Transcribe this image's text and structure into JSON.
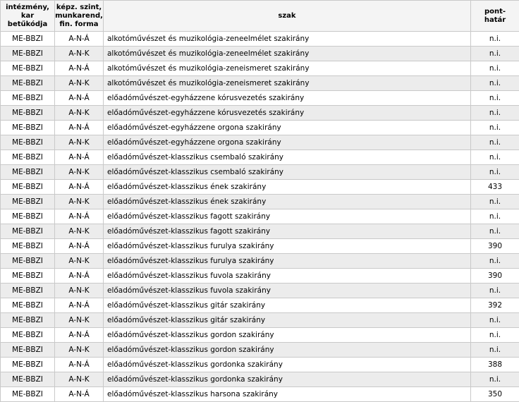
{
  "header": {
    "col1": [
      "intézmény,",
      "kar betűkódja"
    ],
    "col2": [
      "képz. szint,",
      "munkarend,",
      "fin. forma"
    ],
    "col3": "szak",
    "col4": [
      "pont-",
      "határ"
    ]
  },
  "rows": [
    {
      "inst": "ME-BBZI",
      "form": "A-N-Á",
      "major": "alkotóművészet és muzikológia-zeneelmélet szakirány",
      "score": "n.i."
    },
    {
      "inst": "ME-BBZI",
      "form": "A-N-K",
      "major": "alkotóművészet és muzikológia-zeneelmélet szakirány",
      "score": "n.i."
    },
    {
      "inst": "ME-BBZI",
      "form": "A-N-Á",
      "major": "alkotóművészet és muzikológia-zeneismeret szakirány",
      "score": "n.i."
    },
    {
      "inst": "ME-BBZI",
      "form": "A-N-K",
      "major": "alkotóművészet és muzikológia-zeneismeret szakirány",
      "score": "n.i."
    },
    {
      "inst": "ME-BBZI",
      "form": "A-N-Á",
      "major": "előadóművészet-egyházzene kórusvezetés szakirány",
      "score": "n.i."
    },
    {
      "inst": "ME-BBZI",
      "form": "A-N-K",
      "major": "előadóművészet-egyházzene kórusvezetés szakirány",
      "score": "n.i."
    },
    {
      "inst": "ME-BBZI",
      "form": "A-N-Á",
      "major": "előadóművészet-egyházzene orgona szakirány",
      "score": "n.i."
    },
    {
      "inst": "ME-BBZI",
      "form": "A-N-K",
      "major": "előadóművészet-egyházzene orgona szakirány",
      "score": "n.i."
    },
    {
      "inst": "ME-BBZI",
      "form": "A-N-Á",
      "major": "előadóművészet-klasszikus csembaló szakirány",
      "score": "n.i."
    },
    {
      "inst": "ME-BBZI",
      "form": "A-N-K",
      "major": "előadóművészet-klasszikus csembaló szakirány",
      "score": "n.i."
    },
    {
      "inst": "ME-BBZI",
      "form": "A-N-Á",
      "major": "előadóművészet-klasszikus ének szakirány",
      "score": "433"
    },
    {
      "inst": "ME-BBZI",
      "form": "A-N-K",
      "major": "előadóművészet-klasszikus ének szakirány",
      "score": "n.i."
    },
    {
      "inst": "ME-BBZI",
      "form": "A-N-Á",
      "major": "előadóművészet-klasszikus fagott szakirány",
      "score": "n.i."
    },
    {
      "inst": "ME-BBZI",
      "form": "A-N-K",
      "major": "előadóművészet-klasszikus fagott szakirány",
      "score": "n.i."
    },
    {
      "inst": "ME-BBZI",
      "form": "A-N-Á",
      "major": "előadóművészet-klasszikus furulya szakirány",
      "score": "390"
    },
    {
      "inst": "ME-BBZI",
      "form": "A-N-K",
      "major": "előadóművészet-klasszikus furulya szakirány",
      "score": "n.i."
    },
    {
      "inst": "ME-BBZI",
      "form": "A-N-Á",
      "major": "előadóművészet-klasszikus fuvola szakirány",
      "score": "390"
    },
    {
      "inst": "ME-BBZI",
      "form": "A-N-K",
      "major": "előadóművészet-klasszikus fuvola szakirány",
      "score": "n.i."
    },
    {
      "inst": "ME-BBZI",
      "form": "A-N-Á",
      "major": "előadóművészet-klasszikus gitár szakirány",
      "score": "392"
    },
    {
      "inst": "ME-BBZI",
      "form": "A-N-K",
      "major": "előadóművészet-klasszikus gitár szakirány",
      "score": "n.i."
    },
    {
      "inst": "ME-BBZI",
      "form": "A-N-Á",
      "major": "előadóművészet-klasszikus gordon szakirány",
      "score": "n.i."
    },
    {
      "inst": "ME-BBZI",
      "form": "A-N-K",
      "major": "előadóművészet-klasszikus gordon szakirány",
      "score": "n.i."
    },
    {
      "inst": "ME-BBZI",
      "form": "A-N-Á",
      "major": "előadóművészet-klasszikus gordonka szakirány",
      "score": "388"
    },
    {
      "inst": "ME-BBZI",
      "form": "A-N-K",
      "major": "előadóművészet-klasszikus gordonka szakirány",
      "score": "n.i."
    },
    {
      "inst": "ME-BBZI",
      "form": "A-N-Á",
      "major": "előadóművészet-klasszikus harsona szakirány",
      "score": "350"
    }
  ]
}
